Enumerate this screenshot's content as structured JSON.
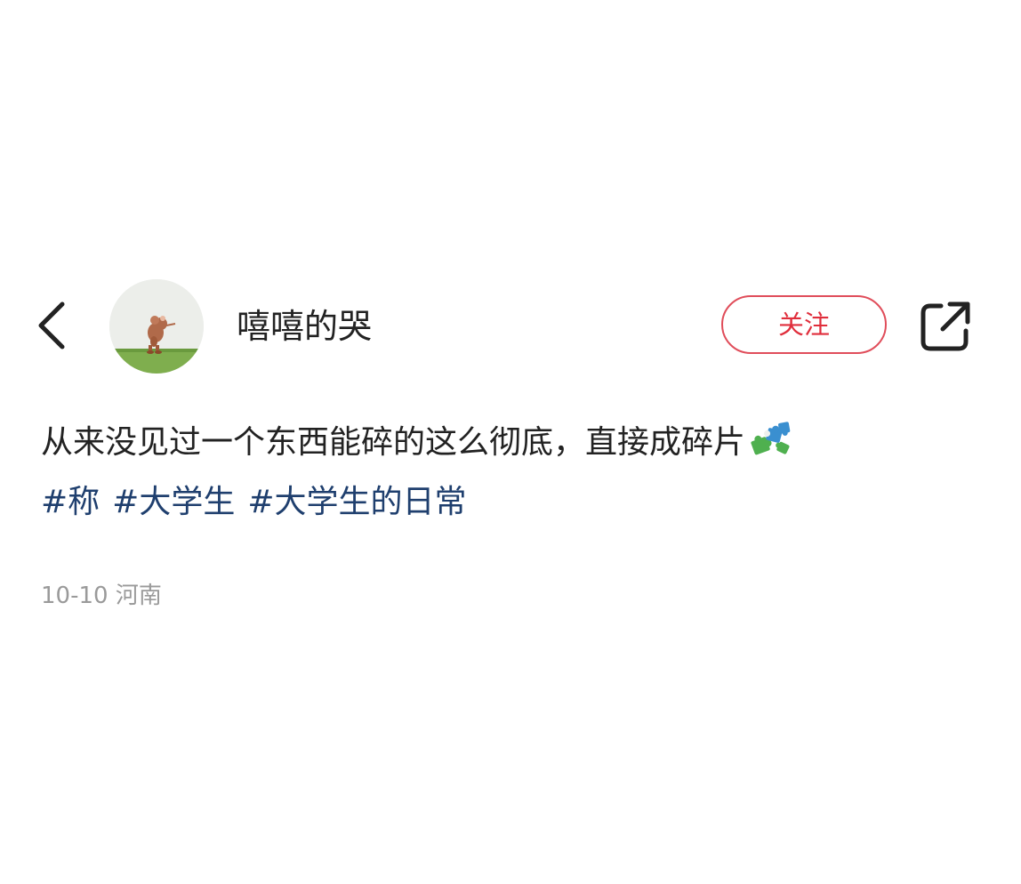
{
  "header": {
    "username": "嘻嘻的哭",
    "follow_label": "关注",
    "back_icon": "chevron-left-icon",
    "share_icon": "share-external-icon"
  },
  "post": {
    "text": "从来没见过一个东西能碎的这么彻底，直接成碎片",
    "emoji_icon": "puzzle-pieces-icon",
    "tags": [
      "#称",
      "#大学生",
      "#大学生的日常"
    ],
    "date": "10-10",
    "location": "河南"
  },
  "colors": {
    "follow_accent": "#e02e3c",
    "tag_color": "#1f3f6e",
    "meta_color": "#9a9a9a"
  }
}
